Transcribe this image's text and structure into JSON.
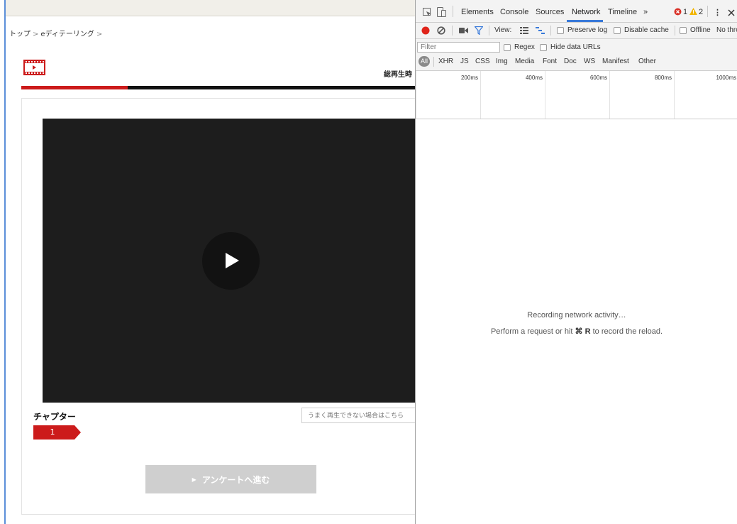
{
  "page": {
    "breadcrumb": {
      "home": "トップ",
      "sep1": ">",
      "current": "eディテーリング",
      "sep2": ">"
    },
    "total_time_label": "総再生時",
    "progress": {
      "fraction": 0.27
    },
    "chapters": {
      "title": "チャプター",
      "items": [
        "1"
      ]
    },
    "help_link": "うまく再生できない場合はこちら",
    "survey_button": "アンケートへ進む",
    "colors": {
      "accent": "#cc1b1b",
      "video_bg": "#1d1d1d"
    }
  },
  "devtools": {
    "tabs": [
      "Elements",
      "Console",
      "Sources",
      "Network",
      "Timeline"
    ],
    "active_tab": "Network",
    "overflow": "»",
    "errors": "1",
    "warnings": "2",
    "toolbar": {
      "view_label": "View:",
      "preserve_log": "Preserve log",
      "disable_cache": "Disable cache",
      "offline": "Offline",
      "throttling": "No thro"
    },
    "filter": {
      "placeholder": "Filter",
      "regex": "Regex",
      "hide_data_urls": "Hide data URLs"
    },
    "types": [
      "All",
      "XHR",
      "JS",
      "CSS",
      "Img",
      "Media",
      "Font",
      "Doc",
      "WS",
      "Manifest",
      "Other"
    ],
    "timeline_ticks": [
      "200ms",
      "400ms",
      "600ms",
      "800ms",
      "1000ms"
    ],
    "empty_message": {
      "line1": "Recording network activity…",
      "line2_prefix": "Perform a request or hit ",
      "shortcut": "⌘ R",
      "line2_suffix": " to record the reload."
    }
  }
}
